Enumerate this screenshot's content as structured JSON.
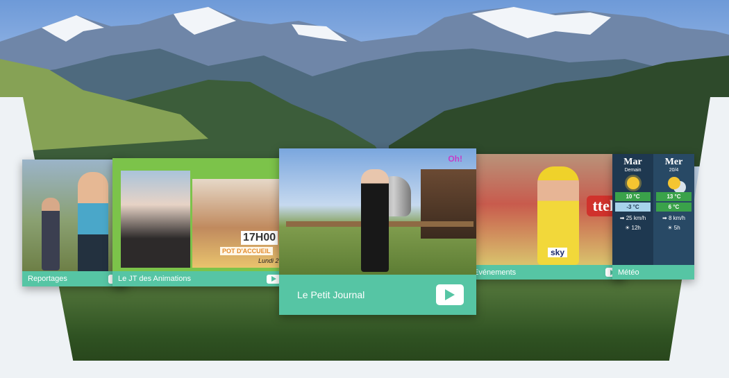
{
  "carousel": {
    "cards": [
      {
        "label": "Reportages"
      },
      {
        "label": "Le JT des Animations",
        "poster": {
          "time": "17H00",
          "event": "POT D'ACCUEIL",
          "day": "Lundi 2"
        }
      },
      {
        "label": "Le Petit Journal",
        "channel_logo": "Oh!"
      },
      {
        "label": "Evénements",
        "banner": "ttel",
        "jersey": "sky"
      },
      {
        "label": "Météo"
      }
    ]
  },
  "weather": {
    "days": [
      {
        "day": "Mar",
        "sub": "Demain",
        "max": "10 °C",
        "min": "-3 °C",
        "wind": "25 km/h",
        "sun": "12h",
        "icon": "sun-icon"
      },
      {
        "day": "Mer",
        "sub": "20/4",
        "max": "13 °C",
        "min": "6 °C",
        "wind": "8 km/h",
        "sun": "5h",
        "icon": "sun-cloud-icon"
      }
    ]
  },
  "colors": {
    "accent": "#56c5a4",
    "weather_bg": "#1e3850",
    "animations_green": "#7cc34a"
  }
}
